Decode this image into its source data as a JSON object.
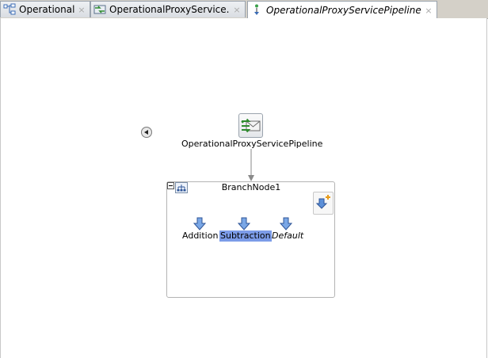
{
  "tabs": [
    {
      "label": "OperationalBR",
      "icon": "business-rule-icon",
      "active": false,
      "italic": false
    },
    {
      "label": "OperationalProxyService.proxy",
      "icon": "proxy-service-icon",
      "active": false,
      "italic": false
    },
    {
      "label": "OperationalProxyServicePipeline.pipeline",
      "icon": "pipeline-icon",
      "active": true,
      "italic": true
    }
  ],
  "close_glyph": "×",
  "pipeline": {
    "label": "OperationalProxyServicePipeline",
    "icon": "pipeline-envelope-icon"
  },
  "branch_node": {
    "title": "BranchNode1",
    "add_icon": "add-action-icon",
    "branches": [
      {
        "label": "Addition",
        "selected": false,
        "italic": false
      },
      {
        "label": "Subtraction",
        "selected": true,
        "italic": false
      },
      {
        "label": "Default",
        "selected": false,
        "italic": true
      }
    ]
  },
  "colors": {
    "selection": "#7c9ce8",
    "arrow_fill": "#5b8fd8",
    "connector": "#8a8a8a"
  }
}
